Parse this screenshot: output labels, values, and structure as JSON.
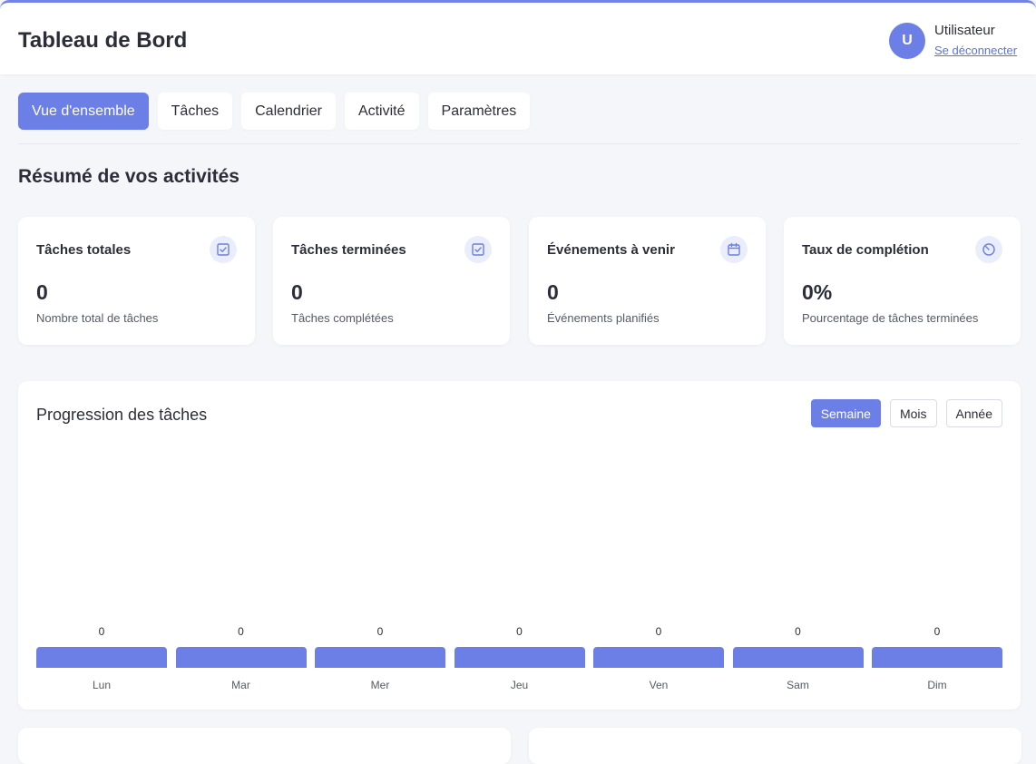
{
  "header": {
    "title": "Tableau de Bord",
    "avatar_initial": "U",
    "user_name": "Utilisateur",
    "logout_label": "Se déconnecter"
  },
  "tabs": [
    {
      "label": "Vue d'ensemble",
      "active": true
    },
    {
      "label": "Tâches",
      "active": false
    },
    {
      "label": "Calendrier",
      "active": false
    },
    {
      "label": "Activité",
      "active": false
    },
    {
      "label": "Paramètres",
      "active": false
    }
  ],
  "summary": {
    "title": "Résumé de vos activités",
    "cards": [
      {
        "label": "Tâches totales",
        "value": "0",
        "description": "Nombre total de tâches",
        "icon": "task-check-icon"
      },
      {
        "label": "Tâches terminées",
        "value": "0",
        "description": "Tâches complétées",
        "icon": "task-check-icon"
      },
      {
        "label": "Événements à venir",
        "value": "0",
        "description": "Événements planifiés",
        "icon": "calendar-icon"
      },
      {
        "label": "Taux de complétion",
        "value": "0%",
        "description": "Pourcentage de tâches terminées",
        "icon": "gauge-icon"
      }
    ]
  },
  "progress": {
    "title": "Progression des tâches",
    "periods": [
      {
        "label": "Semaine",
        "active": true
      },
      {
        "label": "Mois",
        "active": false
      },
      {
        "label": "Année",
        "active": false
      }
    ]
  },
  "colors": {
    "accent": "#6b7fe6",
    "background": "#f5f6fa",
    "card": "#ffffff",
    "text": "#2d2d3a"
  },
  "chart_data": {
    "type": "bar",
    "title": "Progression des tâches",
    "categories": [
      "Lun",
      "Mar",
      "Mer",
      "Jeu",
      "Ven",
      "Sam",
      "Dim"
    ],
    "values": [
      0,
      0,
      0,
      0,
      0,
      0,
      0
    ],
    "xlabel": "",
    "ylabel": "",
    "grid": false
  }
}
